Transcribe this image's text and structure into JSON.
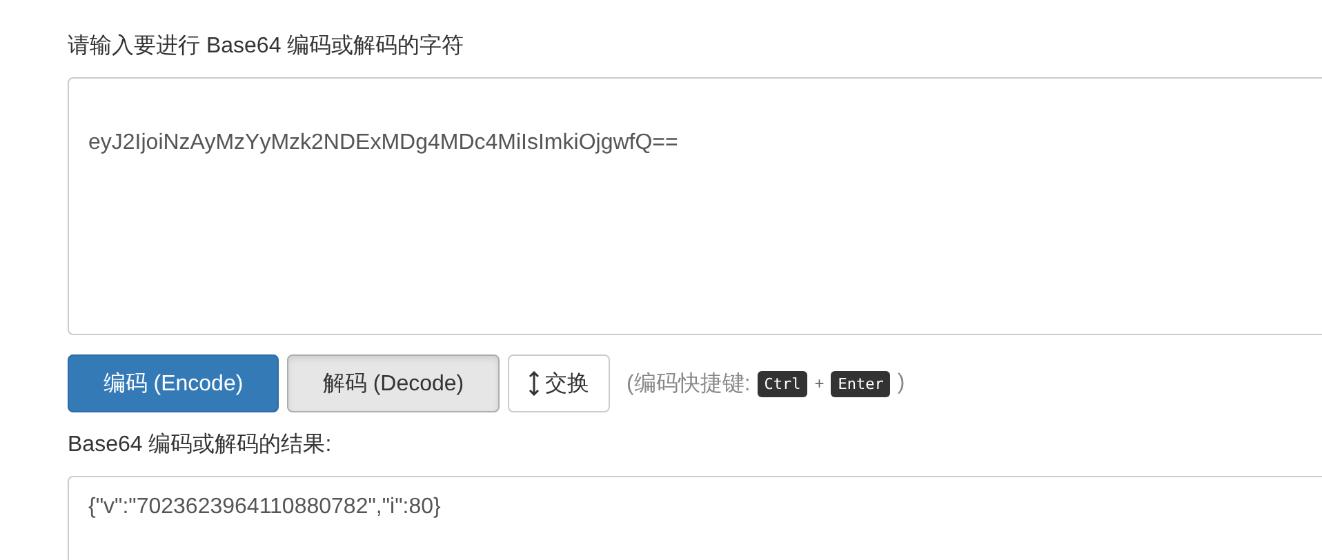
{
  "input": {
    "label": "请输入要进行 Base64 编码或解码的字符",
    "value": "eyJ2IjoiNzAyMzYyMzk2NDExMDg4MDc4MiIsImkiOjgwfQ=="
  },
  "buttons": [
    {
      "kind": "primary",
      "label": "编码 (Encode)",
      "pressed": false
    },
    {
      "kind": "default",
      "label": "解码 (Decode)",
      "pressed": true
    },
    {
      "kind": "swap",
      "label": "交换",
      "pressed": false
    }
  ],
  "shortcut": {
    "prefix": "(编码快捷键:",
    "keys": [
      "Ctrl",
      "Enter"
    ],
    "joiner": "+",
    "suffix": ")"
  },
  "output": {
    "label": "Base64 编码或解码的结果:",
    "value": "{\"v\":\"7023623964110880782\",\"i\":80}"
  }
}
